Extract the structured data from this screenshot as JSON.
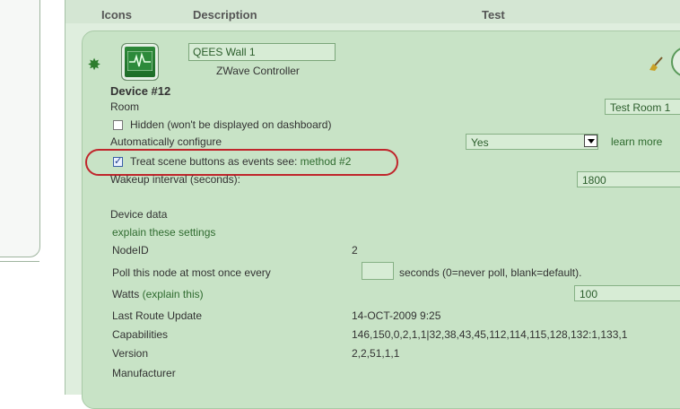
{
  "table_header": {
    "icons": "Icons",
    "description": "Description",
    "test": "Test"
  },
  "device": {
    "name_value": "QEES Wall 1",
    "type": "ZWave Controller",
    "number": "Device #12",
    "room_label": "Room",
    "room_value": "Test Room 1",
    "hidden_label": "Hidden (won't be displayed on dashboard)",
    "hidden_checked": false,
    "auto_config_label": "Automatically configure",
    "auto_config_value": "Yes",
    "learn_more": "learn more",
    "scene_label": "Treat scene buttons as events see: ",
    "scene_link": "method #2",
    "scene_checked": true,
    "wakeup_label": "Wakeup interval (seconds):",
    "wakeup_value": "1800"
  },
  "device_data": {
    "heading": "Device data",
    "explain_link": "explain these settings",
    "nodeid_label": "NodeID",
    "nodeid_value": "2",
    "poll_label": "Poll this node at most once every",
    "poll_value": "",
    "poll_hint": "seconds (0=never poll, blank=default).",
    "watts_label": "Watts",
    "watts_explain": "(explain this)",
    "watts_value": "100",
    "last_route_label": "Last Route Update",
    "last_route_value": "14-OCT-2009 9:25",
    "capabilities_label": "Capabilities",
    "capabilities_value": "146,150,0,2,1,1|32,38,43,45,112,114,115,128,132:1,133,1",
    "version_label": "Version",
    "version_value": "2,2,51,1,1",
    "manufacturer_label": "Manufacturer"
  },
  "colors": {
    "accent_green": "#2f6b2f",
    "highlight_red": "#c0252b",
    "panel_bg": "#c8e3c6"
  },
  "icons": [
    "gear-icon",
    "device-pulse-icon",
    "broom-icon",
    "circle-action-icon",
    "dropdown-arrow-icon"
  ]
}
